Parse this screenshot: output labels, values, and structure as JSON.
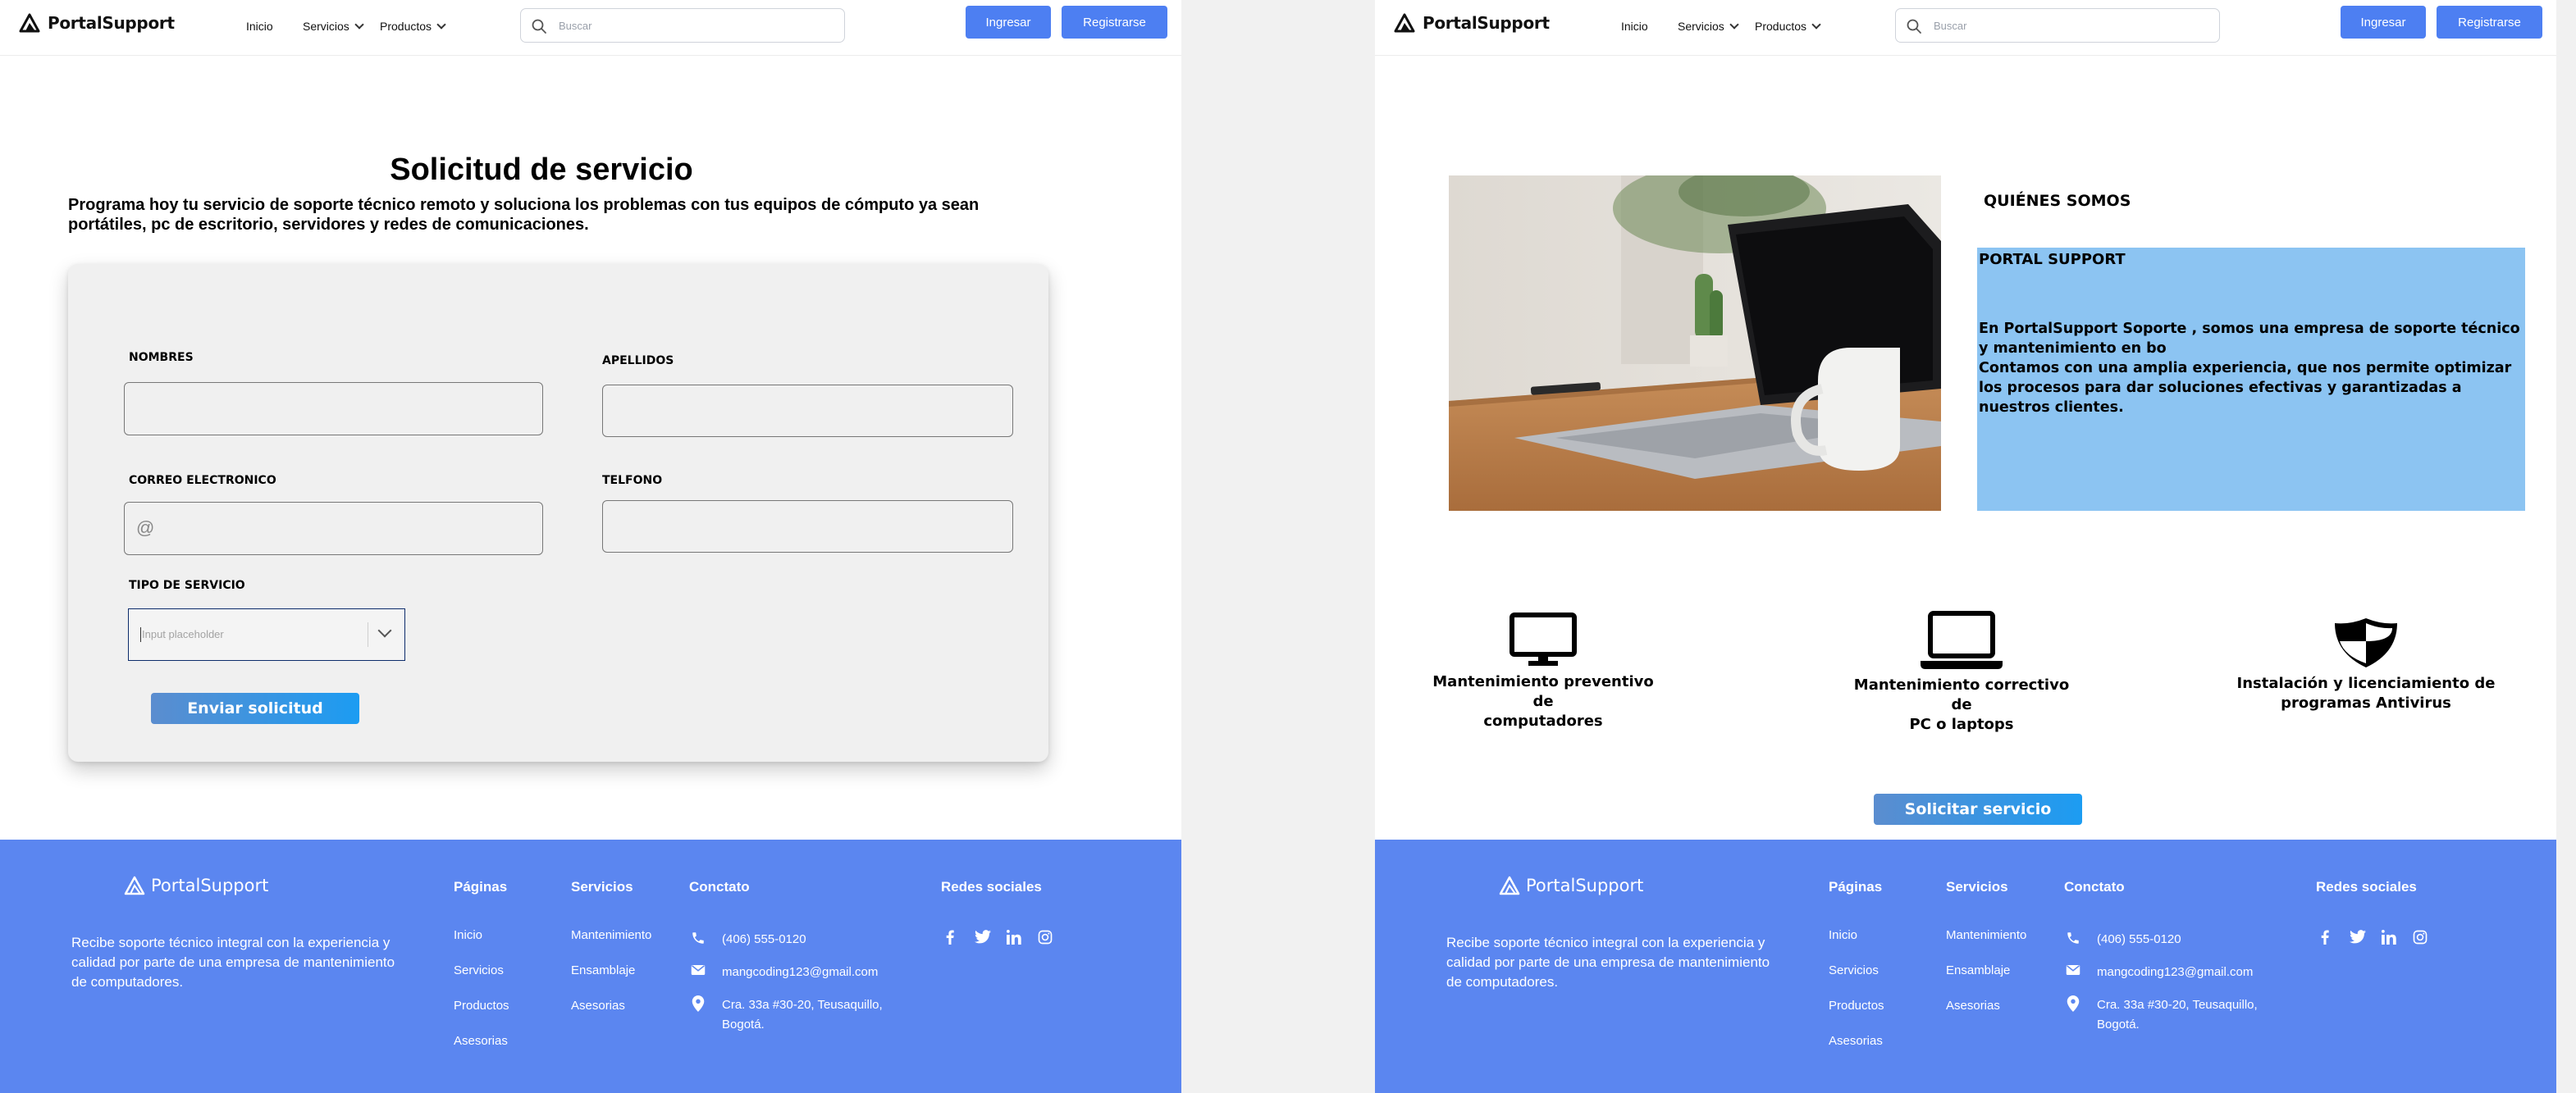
{
  "brand": {
    "name": "PortalSupport"
  },
  "nav": {
    "home": "Inicio",
    "services": "Servicios",
    "products": "Productos",
    "search_placeholder": "Buscar",
    "login": "Ingresar",
    "register": "Registrarse"
  },
  "form": {
    "title": "Solicitud de servicio",
    "subtitle": "Programa hoy tu servicio de soporte técnico remoto y soluciona los problemas con tus equipos de cómputo ya sean portátiles, pc de escritorio, servidores y redes de comunicaciones.",
    "first_name_label": "NOMBRES",
    "last_name_label": "APELLIDOS",
    "email_label": "CORREO ELECTRONICO",
    "email_prefix": "@",
    "phone_label": "TELFONO",
    "service_type_label": "TIPO DE SERVICIO",
    "service_type_placeholder": "Input placeholder",
    "submit_label": "Enviar solicitud"
  },
  "about": {
    "heading": "QUIÉNES SOMOS",
    "box_title": "PORTAL SUPPORT",
    "paragraph_1": "En PortalSupport Soporte , somos una empresa de soporte técnico y mantenimiento en bo",
    "paragraph_2": "Contamos con una amplia experiencia, que nos permite optimizar los procesos para dar soluciones efectivas y garantizadas a nuestros clientes."
  },
  "services": [
    {
      "icon": "monitor-icon",
      "line1": "Mantenimiento preventivo de",
      "line2": "computadores"
    },
    {
      "icon": "laptop-icon",
      "line1": "Mantenimiento correctivo de",
      "line2": "PC o laptops"
    },
    {
      "icon": "shield-icon",
      "line1": "Instalación y licenciamiento de",
      "line2": "programas Antivirus"
    }
  ],
  "cta": {
    "label": "Solicitar servicio"
  },
  "footer": {
    "description": "Recibe soporte técnico integral con la experiencia y calidad por parte de una empresa de mantenimiento de computadores.",
    "pages_heading": "Páginas",
    "pages": [
      "Inicio",
      "Servicios",
      "Productos",
      "Asesorias"
    ],
    "services_heading": "Servicios",
    "services": [
      "Mantenimiento",
      "Ensamblaje",
      "Asesorias"
    ],
    "contact_heading": "Conctato",
    "phone": "(406) 555-0120",
    "email": "mangcoding123@gmail.com",
    "address_line1": "Cra. 33a #30-20, Teusaquillo,",
    "address_line2": "Bogotá.",
    "social_heading": "Redes sociales",
    "social_icons": [
      "facebook-icon",
      "twitter-icon",
      "linkedin-icon",
      "instagram-icon"
    ]
  },
  "colors": {
    "primary": "#4d7ff2",
    "footer_bg": "#5b86f0",
    "about_box": "#8cc4f2",
    "card_bg": "#f0f0f0"
  }
}
